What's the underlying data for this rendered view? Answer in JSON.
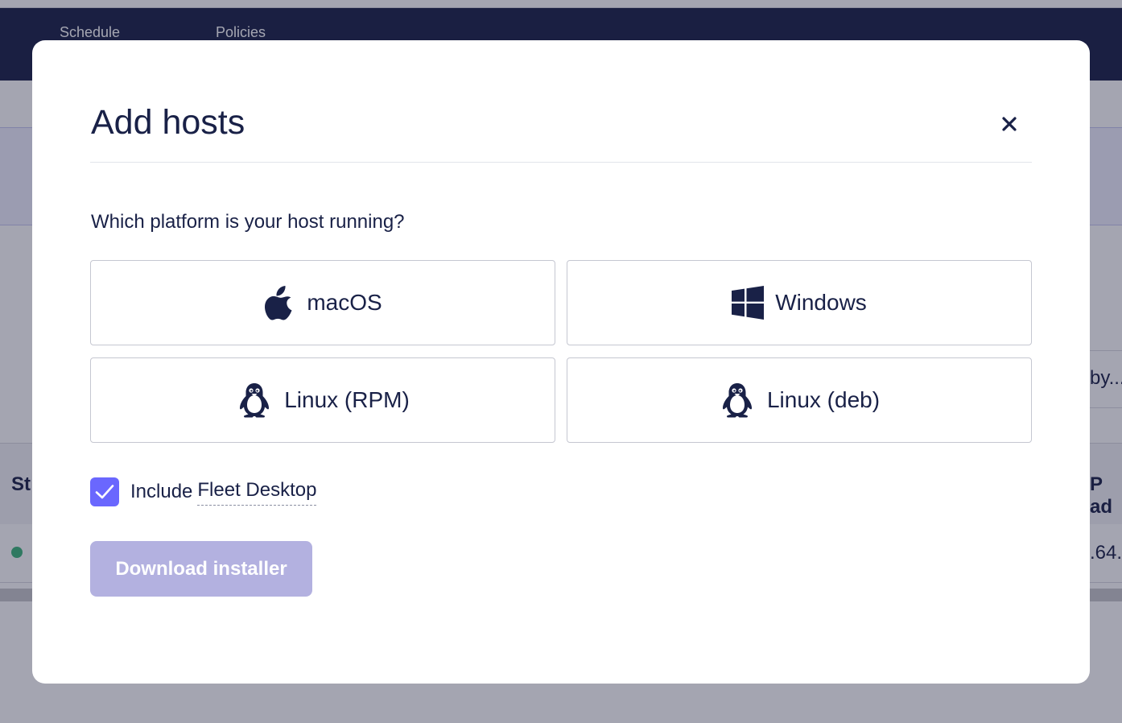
{
  "background": {
    "nav_items": [
      "Schedule",
      "Policies"
    ],
    "filter_text": "by...",
    "table_header_status": "St",
    "table_header_ip": "P ad",
    "row_ip": ".64.",
    "status_color": "#3db67b"
  },
  "modal": {
    "title": "Add hosts",
    "close_label": "×",
    "question": "Which platform is your host running?",
    "platforms": [
      {
        "label": "macOS",
        "icon": "apple-icon"
      },
      {
        "label": "Windows",
        "icon": "windows-icon"
      },
      {
        "label": "Linux (RPM)",
        "icon": "linux-penguin-icon"
      },
      {
        "label": "Linux (deb)",
        "icon": "linux-penguin-icon"
      }
    ],
    "include_checkbox": {
      "checked": true,
      "label_prefix": "Include",
      "label_term": "Fleet Desktop"
    },
    "download_label": "Download installer"
  },
  "colors": {
    "header_bg": "#192147",
    "text": "#192147",
    "accent": "#6a67fe",
    "button_disabled": "#b3b1e0"
  }
}
